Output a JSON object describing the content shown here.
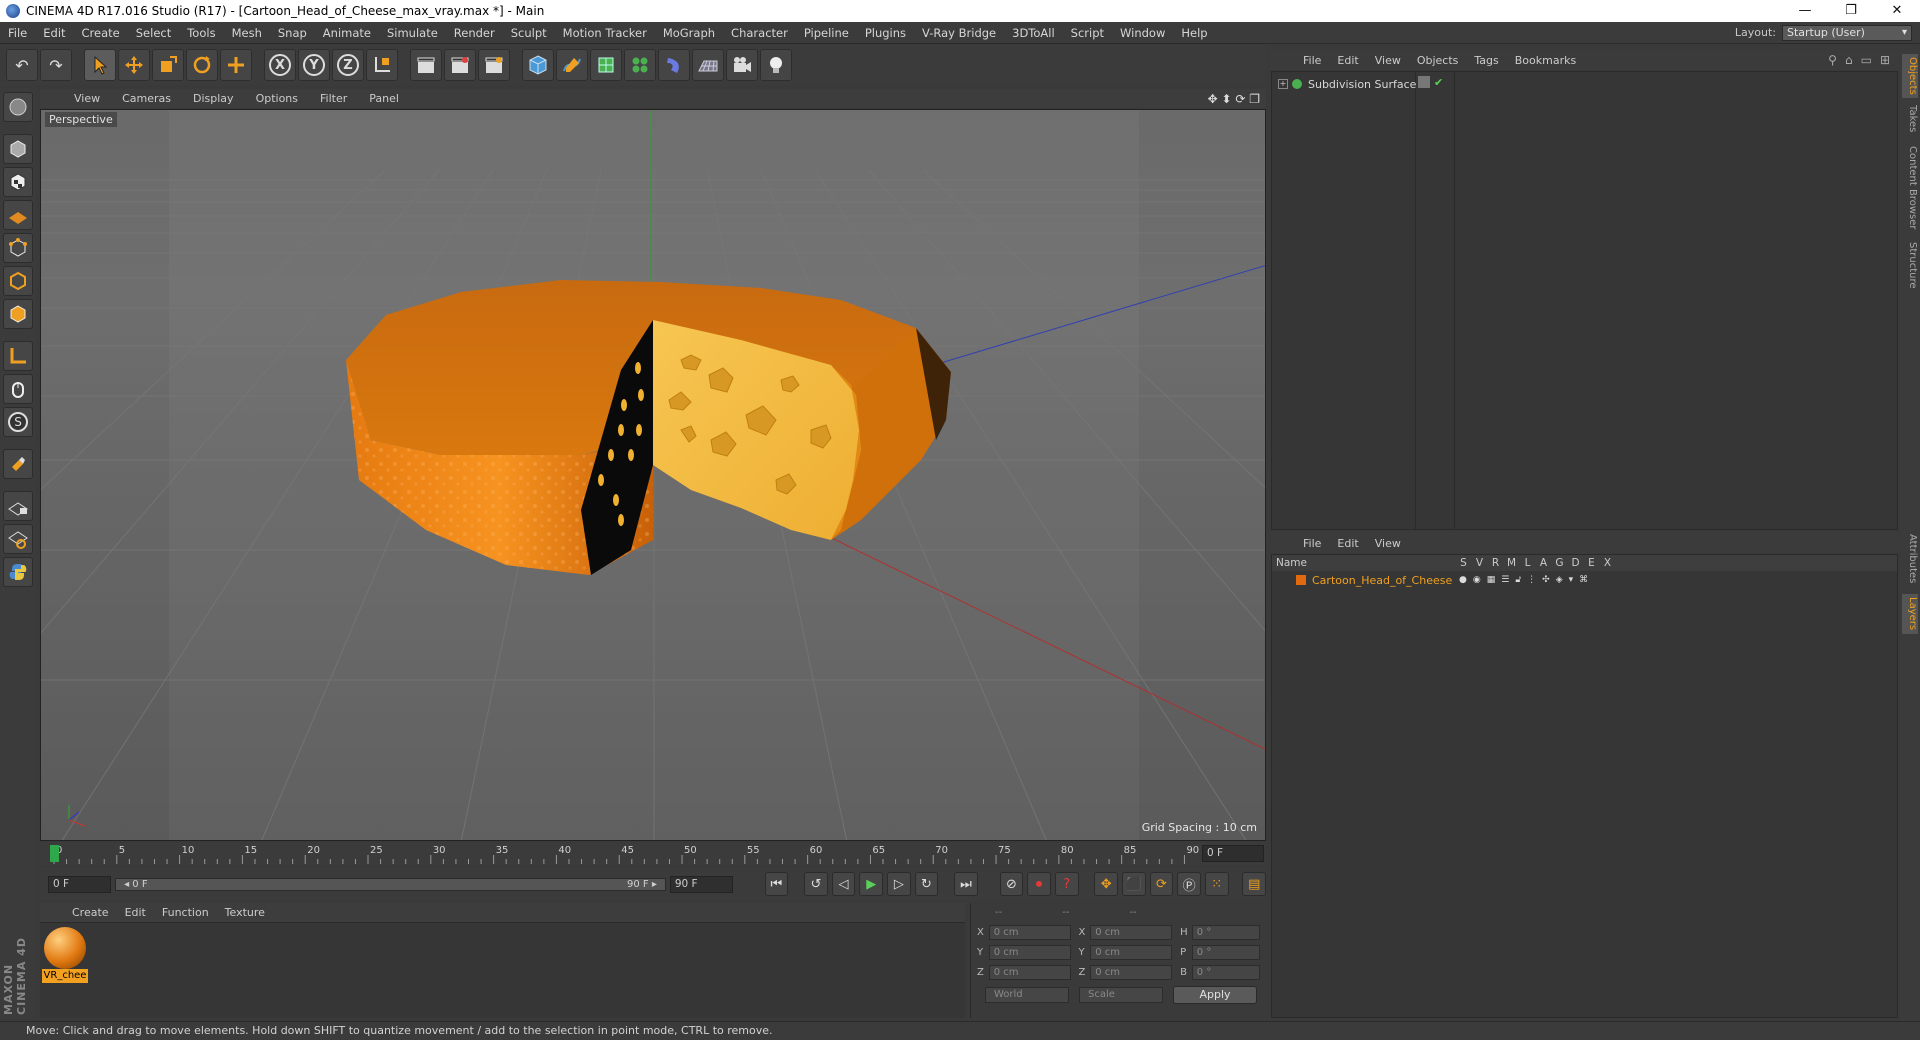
{
  "window": {
    "title": "CINEMA 4D R17.016 Studio (R17) - [Cartoon_Head_of_Cheese_max_vray.max *] - Main",
    "controls": [
      "—",
      "❐",
      "✕"
    ]
  },
  "menubar": {
    "items": [
      "File",
      "Edit",
      "Create",
      "Select",
      "Tools",
      "Mesh",
      "Snap",
      "Animate",
      "Simulate",
      "Render",
      "Sculpt",
      "Motion Tracker",
      "MoGraph",
      "Character",
      "Pipeline",
      "Plugins",
      "V-Ray Bridge",
      "3DToAll",
      "Script",
      "Window",
      "Help"
    ],
    "layout_label": "Layout:",
    "layout_value": "Startup (User)"
  },
  "toolbar": {
    "undo": "↶",
    "redo": "↷",
    "axis_x": "X",
    "axis_y": "Y",
    "axis_z": "Z"
  },
  "viewport": {
    "menu": [
      "View",
      "Cameras",
      "Display",
      "Options",
      "Filter",
      "Panel"
    ],
    "nav_icons": "✥ ⬍ ⟳ ❐",
    "label": "Perspective",
    "grid_spacing": "Grid Spacing : 10 cm",
    "colors": {
      "background": "#5d5d5d",
      "cheese_rind": "#ee8a14",
      "cheese_inside": "#f4bd40",
      "x_axis": "#b03030",
      "y_axis": "#30a030",
      "z_axis": "#3040b0"
    }
  },
  "timeline": {
    "ticks": [
      "0",
      "5",
      "10",
      "15",
      "20",
      "25",
      "30",
      "35",
      "40",
      "45",
      "50",
      "55",
      "60",
      "65",
      "70",
      "75",
      "80",
      "85",
      "90"
    ],
    "current_frame": "0 F"
  },
  "transport": {
    "start_field": "0 F",
    "range_left": "◂ 0 F",
    "range_right": "90 F ▸",
    "end_field": "90 F"
  },
  "material_manager": {
    "menu": [
      "Create",
      "Edit",
      "Function",
      "Texture"
    ],
    "materials": [
      {
        "label": "VR_chee"
      }
    ]
  },
  "coordinates": {
    "header": [
      "--",
      "--",
      "--"
    ],
    "rows": [
      {
        "a1": "X",
        "v1": "0 cm",
        "a2": "X",
        "v2": "0 cm",
        "a3": "H",
        "v3": "0 °"
      },
      {
        "a1": "Y",
        "v1": "0 cm",
        "a2": "Y",
        "v2": "0 cm",
        "a3": "P",
        "v3": "0 °"
      },
      {
        "a1": "Z",
        "v1": "0 cm",
        "a2": "Z",
        "v2": "0 cm",
        "a3": "B",
        "v3": "0 °"
      }
    ],
    "space": "World",
    "mode": "Scale",
    "apply": "Apply"
  },
  "object_manager": {
    "menu": [
      "File",
      "Edit",
      "View",
      "Objects",
      "Tags",
      "Bookmarks"
    ],
    "objects": [
      {
        "name": "Subdivision Surface"
      }
    ]
  },
  "layer_manager": {
    "menu": [
      "File",
      "Edit",
      "View"
    ],
    "name_header": "Name",
    "columns": [
      "S",
      "V",
      "R",
      "M",
      "L",
      "A",
      "G",
      "D",
      "E",
      "X"
    ],
    "layers": [
      {
        "name": "Cartoon_Head_of_Cheese"
      }
    ]
  },
  "side_tabs": [
    "Objects",
    "Takes",
    "Content Browser",
    "Structure",
    "Attributes",
    "Layers"
  ],
  "maxon_logo": "MAXON CINEMA 4D",
  "statusbar": "Move: Click and drag to move elements. Hold down SHIFT to quantize movement / add to the selection in point mode, CTRL to remove."
}
